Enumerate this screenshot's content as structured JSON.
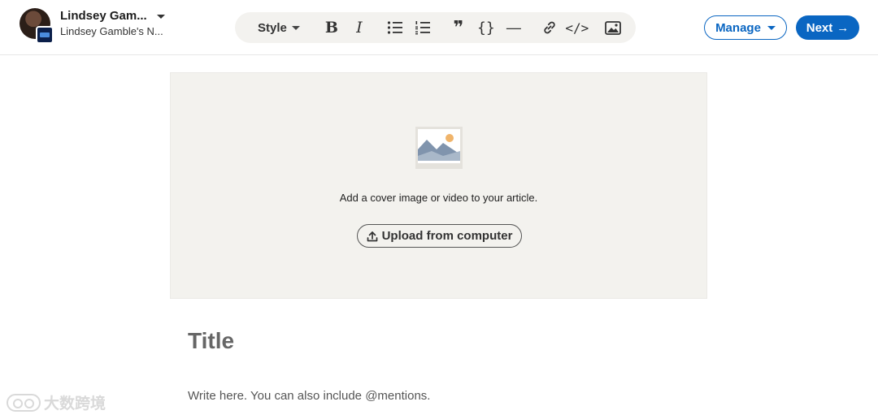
{
  "header": {
    "profile": {
      "name": "Lindsey Gam...",
      "subtitle": "Lindsey Gamble's N..."
    },
    "toolbar": {
      "style_label": "Style",
      "buttons": [
        {
          "name": "bold",
          "glyph": "B"
        },
        {
          "name": "italic",
          "glyph": "I"
        },
        {
          "name": "bulleted-list"
        },
        {
          "name": "numbered-list"
        },
        {
          "name": "quote",
          "glyph": "❞"
        },
        {
          "name": "code-block",
          "glyph": "{}"
        },
        {
          "name": "divider",
          "glyph": "—"
        },
        {
          "name": "link"
        },
        {
          "name": "inline-code",
          "glyph": "</>"
        },
        {
          "name": "image"
        }
      ]
    },
    "manage_label": "Manage",
    "next_label": "Next",
    "next_arrow": "→"
  },
  "cover": {
    "prompt": "Add a cover image or video to your article.",
    "upload_label": "Upload from computer"
  },
  "article": {
    "title_placeholder": "Title",
    "body_placeholder": "Write here. You can also include @mentions."
  },
  "watermark": {
    "text": "大数跨境"
  },
  "colors": {
    "brand": "#0a66c2",
    "cover_bg": "#f3f2ee",
    "toolbar_bg": "#f3f2ef"
  }
}
